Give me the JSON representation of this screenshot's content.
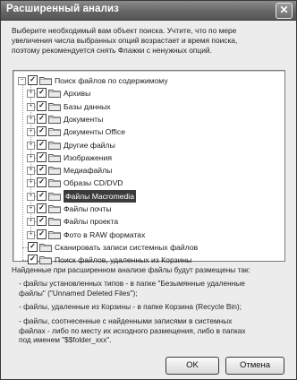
{
  "dialog": {
    "title": "Расширенный анализ",
    "close_glyph": "✕"
  },
  "intro": {
    "line1": "Выберите необходимый вам объект поиска. Учтите, что по мере",
    "line2": "увеличения числа выбранных опций возрастает и время поиска,",
    "line3": "поэтому рекомендуется снять Флажки с ненужных опций."
  },
  "tree": {
    "root": "Поиск файлов по содержимому",
    "items": [
      {
        "label": "Архивы"
      },
      {
        "label": "Базы данных"
      },
      {
        "label": "Документы"
      },
      {
        "label": "Документы Office"
      },
      {
        "label": "Другие файлы"
      },
      {
        "label": "Изображения"
      },
      {
        "label": "Медиафайлы"
      },
      {
        "label": "Образы CD/DVD"
      },
      {
        "label": "Файлы Macromedia"
      },
      {
        "label": "Файлы почты"
      },
      {
        "label": "Файлы проекта"
      },
      {
        "label": "Фото в RAW форматах"
      }
    ],
    "extra1": "Сканировать записи системных файлов",
    "extra2": "Поиск файлов, удаленных из Корзины",
    "selected_index": 8,
    "expand_glyph": "+",
    "collapse_glyph": "−",
    "check_glyph": "✓",
    "folder_icon": "folder-icon"
  },
  "info": {
    "heading": "Найденные при расширенном анализе файлы будут размещены так:",
    "b1_l1": "- файлы установленных типов - в папке \"Безымянные удаленные",
    "b1_l2": "файлы\" (\"Unnamed Deleted Files\");",
    "b2_l1": "- файлы, удаленные из Корзины - в папке Корзина (Recycle Bin);",
    "b3_l1": "- файлы, соотнесенные с найденными записями в системных",
    "b3_l2": "файлах - либо по месту их исходного размещения, либо в папках",
    "b3_l3": "под именем \"$$folder_xxx\"."
  },
  "buttons": {
    "ok": "OK",
    "cancel": "Отмена"
  }
}
